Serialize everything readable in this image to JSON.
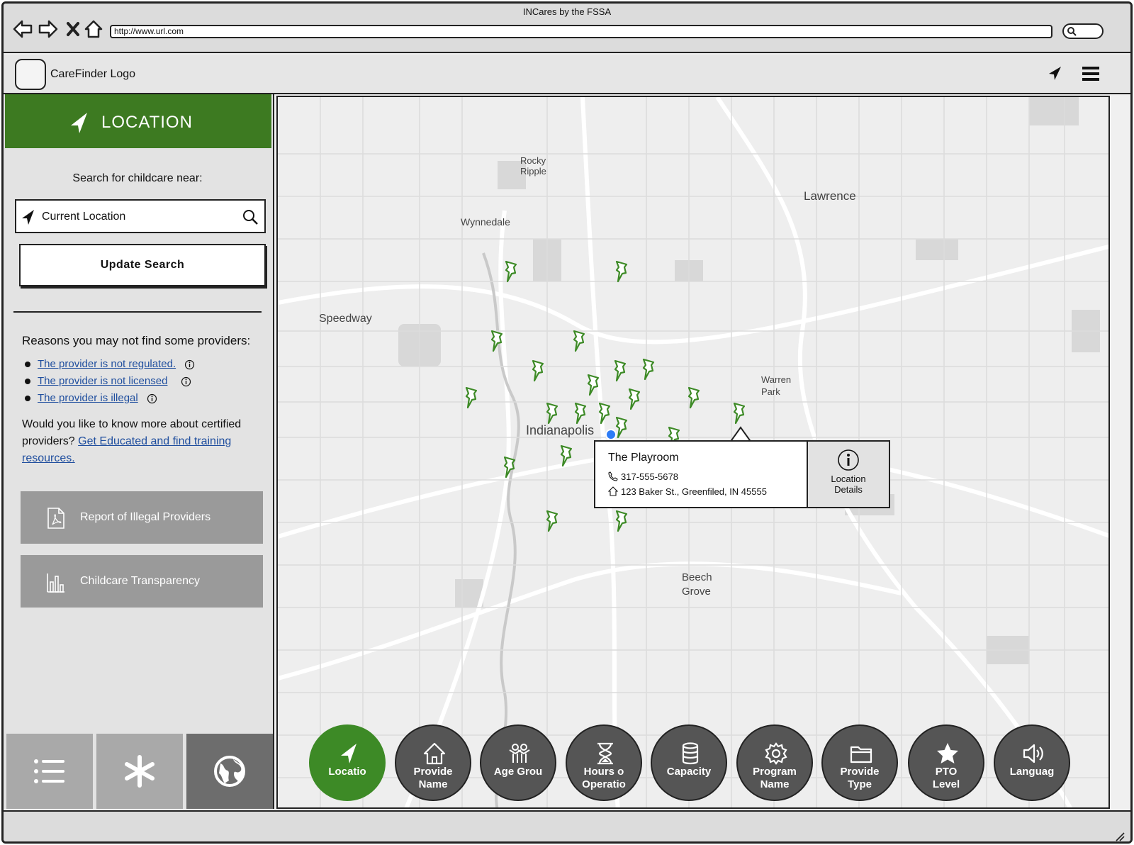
{
  "window": {
    "title": "INCares by the FSSA",
    "url": "http://www.url.com"
  },
  "appbar": {
    "logo_label": "CareFinder Logo"
  },
  "sidebar": {
    "header_label": "LOCATION",
    "search_label": "Search for childcare near:",
    "location_value": "Current Location",
    "update_button": "Update Search",
    "reasons_title": "Reasons you may not find some providers:",
    "reasons": [
      "The provider is not regulated.",
      "The provider is not licensed",
      "The provider is illegal"
    ],
    "learn_text": "Would you like to know more about certified providers?",
    "learn_link": "Get Educated and find training resources.",
    "buttons": [
      {
        "label": "Report of Illegal Providers",
        "icon": "pdf-icon"
      },
      {
        "label": "Childcare Transparency",
        "icon": "bar-chart-icon"
      }
    ]
  },
  "map": {
    "cities": [
      "Indianapolis",
      "Lawrence",
      "Speedway",
      "Wynnedale",
      "Rocky Ripple",
      "Warren Park",
      "Beech Grove"
    ],
    "popup": {
      "name": "The Playroom",
      "phone": "317-555-5678",
      "address": "123 Baker St., Greenfiled, IN 45555",
      "details_line1": "Location",
      "details_line2": "Details"
    },
    "filters": [
      {
        "label": "Locatio",
        "icon": "location-arrow-icon",
        "active": true
      },
      {
        "label": "Provide\nName",
        "icon": "home-icon",
        "active": false
      },
      {
        "label": "Age Grou",
        "icon": "children-icon",
        "active": false
      },
      {
        "label": "Hours o\nOperatio",
        "icon": "hourglass-icon",
        "active": false
      },
      {
        "label": "Capacity",
        "icon": "database-icon",
        "active": false
      },
      {
        "label": "Program\nName",
        "icon": "gear-icon",
        "active": false
      },
      {
        "label": "Provide\nType",
        "icon": "folder-icon",
        "active": false
      },
      {
        "label": "PTO\nLevel",
        "icon": "star-icon",
        "active": false
      },
      {
        "label": "Languag",
        "icon": "speaker-icon",
        "active": false
      }
    ]
  },
  "colors": {
    "accent": "#3d7a21",
    "link": "#1f4e9e",
    "fab": "#555555",
    "pin": "#3d8a26"
  }
}
